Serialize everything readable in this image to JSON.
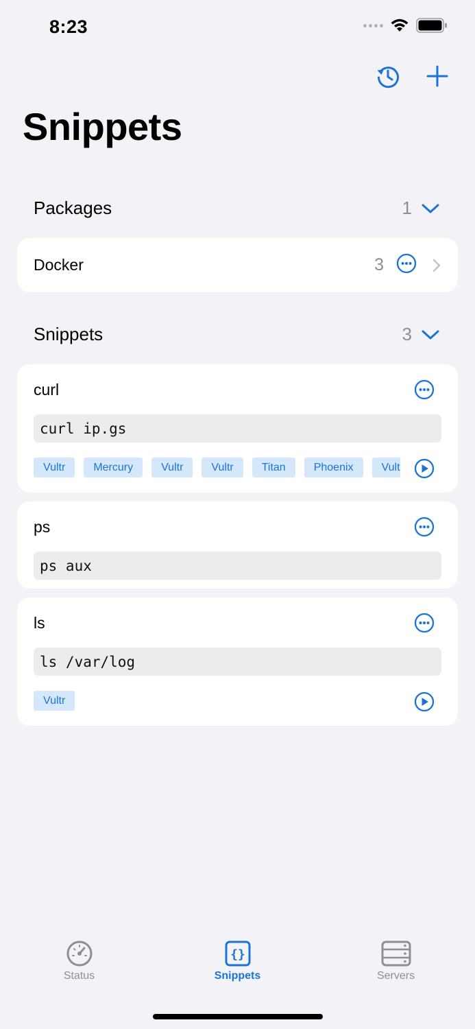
{
  "status_bar": {
    "time": "8:23"
  },
  "header": {
    "title": "Snippets",
    "history_icon": "history-icon",
    "add_icon": "plus-icon"
  },
  "packages": {
    "label": "Packages",
    "count": "1",
    "items": [
      {
        "name": "Docker",
        "count": "3"
      }
    ]
  },
  "snippets": {
    "label": "Snippets",
    "count": "3",
    "items": [
      {
        "name": "curl",
        "command": "curl ip.gs",
        "tags": [
          "Vultr",
          "Mercury",
          "Vultr",
          "Vultr",
          "Titan",
          "Phoenix",
          "Vultr"
        ]
      },
      {
        "name": "ps",
        "command": "ps aux",
        "tags": []
      },
      {
        "name": "ls",
        "command": "ls /var/log",
        "tags": [
          "Vultr"
        ]
      }
    ]
  },
  "tabs": [
    {
      "label": "Status",
      "icon": "gauge-icon"
    },
    {
      "label": "Snippets",
      "icon": "braces-icon",
      "active": true
    },
    {
      "label": "Servers",
      "icon": "server-rack-icon"
    }
  ],
  "colors": {
    "accent": "#1a73d9",
    "background": "#f2f2f7",
    "tag_bg": "#d5e8fb",
    "secondary": "#8e8e93"
  }
}
